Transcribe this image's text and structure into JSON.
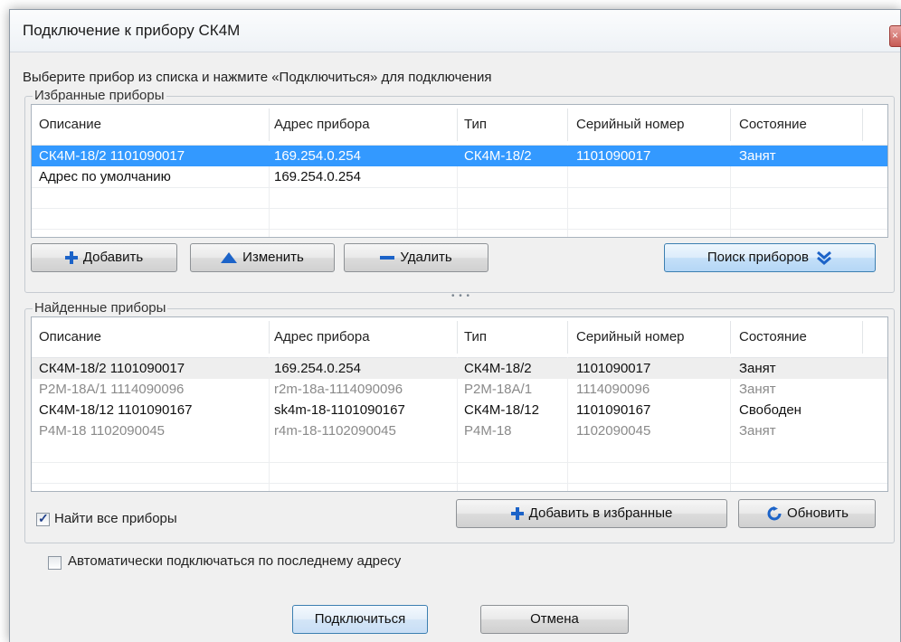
{
  "window": {
    "title": "Подключение к прибору СК4М",
    "close_icon": "close-icon"
  },
  "instruction": "Выберите прибор из списка и нажмите «Подключиться» для подключения",
  "favorites": {
    "label": "Избранные приборы",
    "columns": [
      "Описание",
      "Адрес прибора",
      "Тип",
      "Серийный номер",
      "Состояние"
    ],
    "rows": [
      {
        "desc": "СК4М-18/2  1101090017",
        "addr": "169.254.0.254",
        "type": "СК4М-18/2",
        "serial": "1101090017",
        "state": "Занят",
        "selected": true
      },
      {
        "desc": "Адрес по умолчанию",
        "addr": "169.254.0.254",
        "type": "",
        "serial": "",
        "state": "",
        "selected": false
      }
    ],
    "buttons": {
      "add": "Добавить",
      "edit": "Изменить",
      "delete": "Удалить",
      "search": "Поиск приборов"
    }
  },
  "found": {
    "label": "Найденные приборы",
    "columns": [
      "Описание",
      "Адрес прибора",
      "Тип",
      "Серийный номер",
      "Состояние"
    ],
    "rows": [
      {
        "desc": "СК4М-18/2  1101090017",
        "addr": "169.254.0.254",
        "type": "СК4М-18/2",
        "serial": "1101090017",
        "state": "Занят",
        "style": "dark"
      },
      {
        "desc": "P2M-18A/1 1114090096",
        "addr": "r2m-18a-1114090096",
        "type": "P2M-18A/1",
        "serial": "1114090096",
        "state": "Занят",
        "style": "grey"
      },
      {
        "desc": "СК4М-18/12 1101090167",
        "addr": "sk4m-18-1101090167",
        "type": "СК4М-18/12",
        "serial": "1101090167",
        "state": "Свободен",
        "style": "dark"
      },
      {
        "desc": "P4M-18 1102090045",
        "addr": "r4m-18-1102090045",
        "type": "P4M-18",
        "serial": "1102090045",
        "state": "Занят",
        "style": "grey"
      }
    ],
    "find_all_label": "Найти все приборы",
    "find_all_checked": true,
    "add_fav_button": "Добавить в избранные",
    "refresh_button": "Обновить"
  },
  "auto_connect_label": "Автоматически подключаться по последнему адресу",
  "auto_connect_checked": false,
  "connect_button": "Подключиться",
  "cancel_button": "Отмена",
  "colors": {
    "selection": "#3399ff",
    "accent_icon": "#1c63c8",
    "grey_text": "#8a8a8a"
  }
}
